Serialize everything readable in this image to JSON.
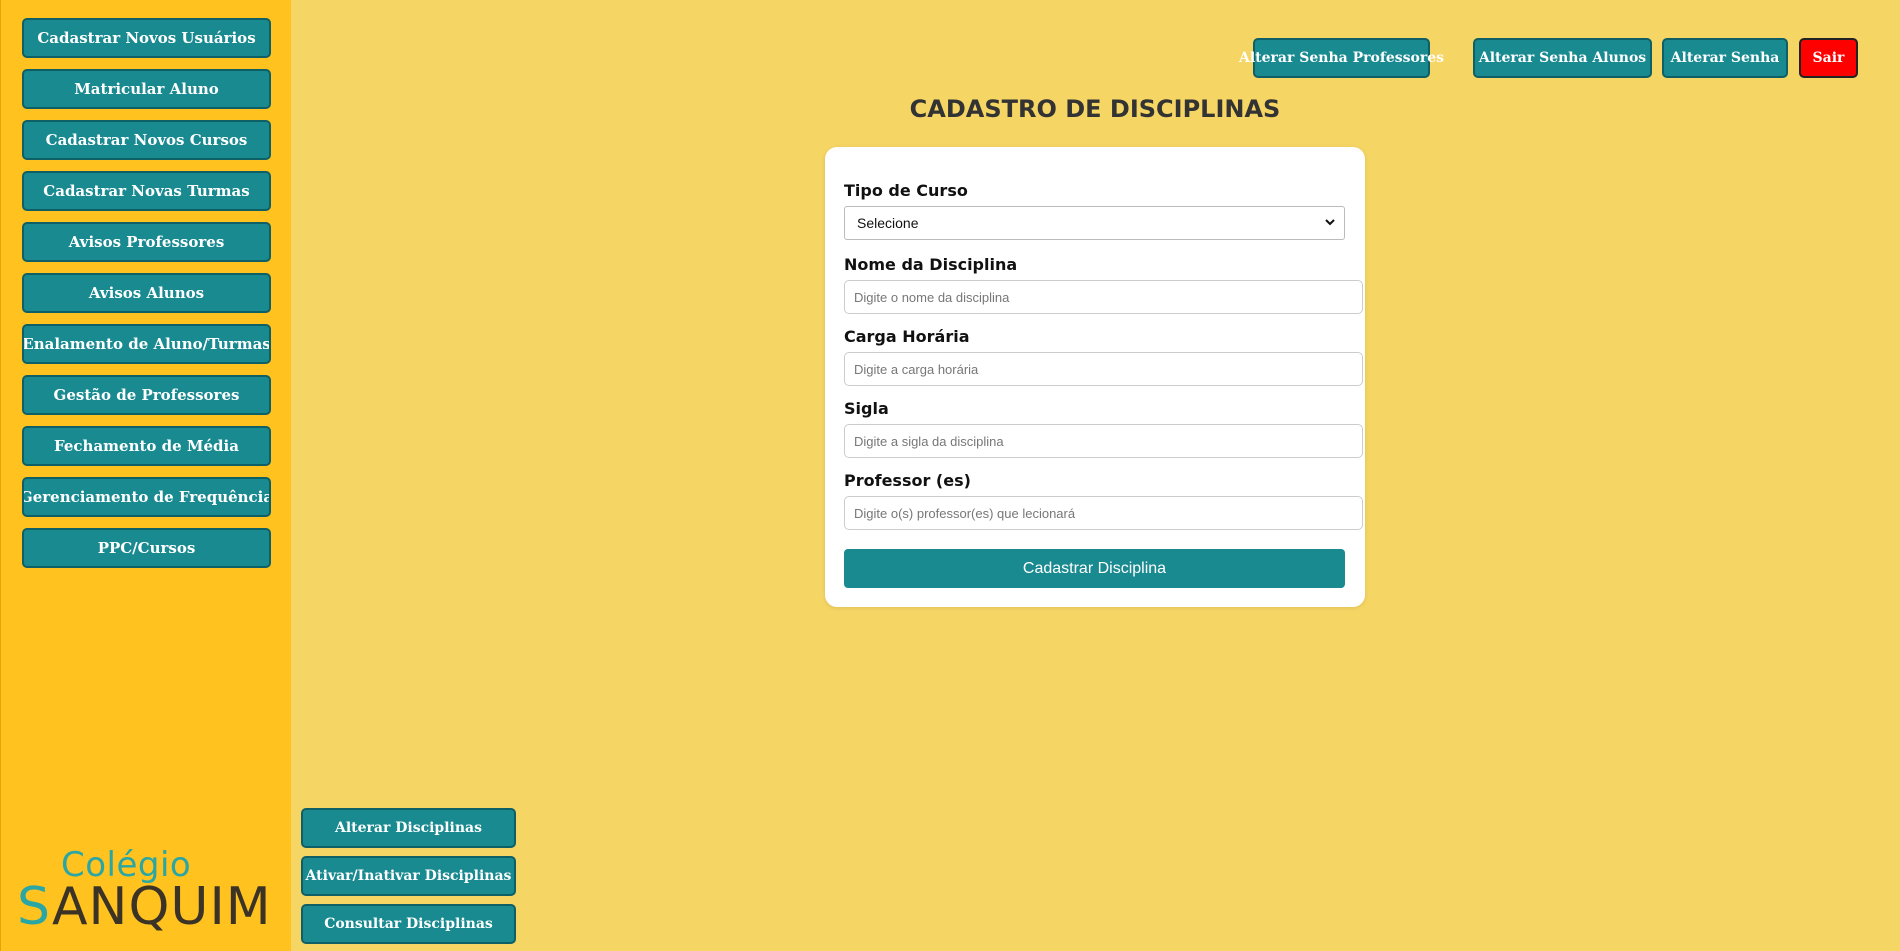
{
  "sidebar": {
    "items": [
      {
        "label": "Cadastrar Novos Usuários"
      },
      {
        "label": "Matricular Aluno"
      },
      {
        "label": "Cadastrar Novos Cursos"
      },
      {
        "label": "Cadastrar Novas Turmas"
      },
      {
        "label": "Avisos Professores"
      },
      {
        "label": "Avisos Alunos"
      },
      {
        "label": "Enalamento de Aluno/Turmas"
      },
      {
        "label": "Gestão de Professores"
      },
      {
        "label": "Fechamento de Média"
      },
      {
        "label": "Gerenciamento de Frequência"
      },
      {
        "label": "PPC/Cursos"
      }
    ],
    "logo": {
      "top": "Colégio",
      "bottom_s": "S",
      "bottom_rest": "ANQUIM"
    }
  },
  "topbar": {
    "buttons": [
      {
        "label": "Alterar Senha Professores"
      },
      {
        "label": "Alterar Senha Alunos"
      },
      {
        "label": "Alterar Senha"
      },
      {
        "label": "Sair"
      }
    ]
  },
  "main": {
    "title": "CADASTRO DE DISCIPLINAS",
    "form": {
      "tipo_curso": {
        "label": "Tipo de Curso",
        "value": "Selecione"
      },
      "nome": {
        "label": "Nome da Disciplina",
        "placeholder": "Digite o nome da disciplina"
      },
      "carga": {
        "label": "Carga Horária",
        "placeholder": "Digite a carga horária"
      },
      "sigla": {
        "label": "Sigla",
        "placeholder": "Digite a sigla da disciplina"
      },
      "professor": {
        "label": "Professor (es)",
        "placeholder": "Digite o(s) professor(es) que lecionará"
      },
      "submit_label": "Cadastrar Disciplina"
    }
  },
  "actions": {
    "buttons": [
      {
        "label": "Alterar Disciplinas"
      },
      {
        "label": "Ativar/Inativar Disciplinas"
      },
      {
        "label": "Consultar Disciplinas"
      }
    ]
  },
  "colors": {
    "background": "#f5d563",
    "sidebar": "#ffc21f",
    "button": "#1a8a91",
    "exit": "#ff0000"
  }
}
